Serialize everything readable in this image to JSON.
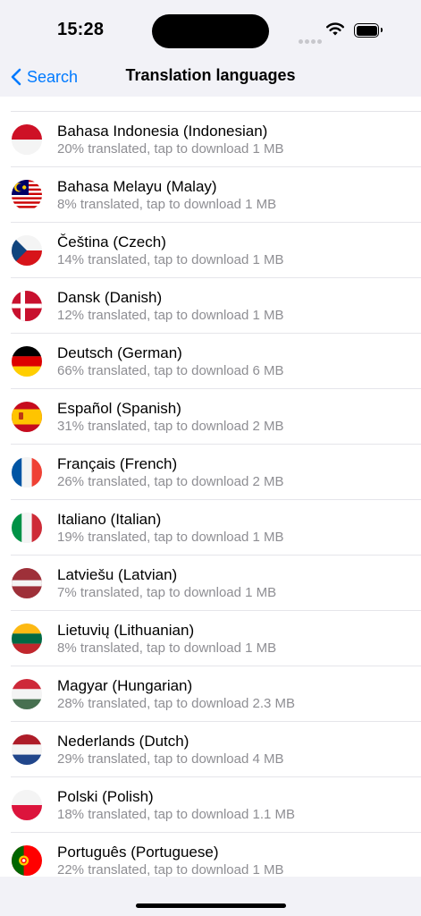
{
  "status_bar": {
    "time": "15:28"
  },
  "nav": {
    "back_label": "Search",
    "title": "Translation languages"
  },
  "languages": [
    {
      "name": "Bahasa Indonesia (Indonesian)",
      "detail": "20% translated, tap to download 1 MB",
      "flag": "indonesia-flag-icon"
    },
    {
      "name": "Bahasa Melayu (Malay)",
      "detail": "8% translated, tap to download 1 MB",
      "flag": "malaysia-flag-icon"
    },
    {
      "name": "Čeština (Czech)",
      "detail": "14% translated, tap to download 1 MB",
      "flag": "czech-flag-icon"
    },
    {
      "name": "Dansk (Danish)",
      "detail": "12% translated, tap to download 1 MB",
      "flag": "denmark-flag-icon"
    },
    {
      "name": "Deutsch (German)",
      "detail": "66% translated, tap to download 6 MB",
      "flag": "germany-flag-icon"
    },
    {
      "name": "Español (Spanish)",
      "detail": "31% translated, tap to download 2 MB",
      "flag": "spain-flag-icon"
    },
    {
      "name": "Français (French)",
      "detail": "26% translated, tap to download 2 MB",
      "flag": "france-flag-icon"
    },
    {
      "name": "Italiano (Italian)",
      "detail": "19% translated, tap to download 1 MB",
      "flag": "italy-flag-icon"
    },
    {
      "name": "Latviešu (Latvian)",
      "detail": "7% translated, tap to download 1 MB",
      "flag": "latvia-flag-icon"
    },
    {
      "name": "Lietuvių (Lithuanian)",
      "detail": "8% translated, tap to download 1 MB",
      "flag": "lithuania-flag-icon"
    },
    {
      "name": "Magyar (Hungarian)",
      "detail": "28% translated, tap to download 2.3 MB",
      "flag": "hungary-flag-icon"
    },
    {
      "name": "Nederlands (Dutch)",
      "detail": "29% translated, tap to download 4 MB",
      "flag": "netherlands-flag-icon"
    },
    {
      "name": "Polski (Polish)",
      "detail": "18% translated, tap to download 1.1 MB",
      "flag": "poland-flag-icon"
    },
    {
      "name": "Português (Portuguese)",
      "detail": "22% translated, tap to download 1 MB",
      "flag": "portugal-flag-icon"
    }
  ],
  "colors": {
    "accent": "#007aff",
    "secondary_text": "#8e8e93",
    "background": "#f2f2f7"
  }
}
